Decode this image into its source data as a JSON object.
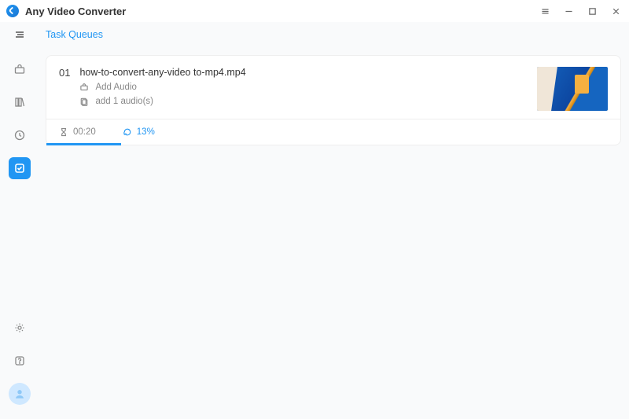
{
  "app": {
    "title": "Any Video Converter"
  },
  "page": {
    "title": "Task Queues"
  },
  "task": {
    "index": "01",
    "filename": "how-to-convert-any-video to-mp4.mp4",
    "add_audio_label": "Add Audio",
    "audio_count_label": "add 1 audio(s)",
    "duration": "00:20",
    "percent_label": "13%",
    "percent": 13
  }
}
